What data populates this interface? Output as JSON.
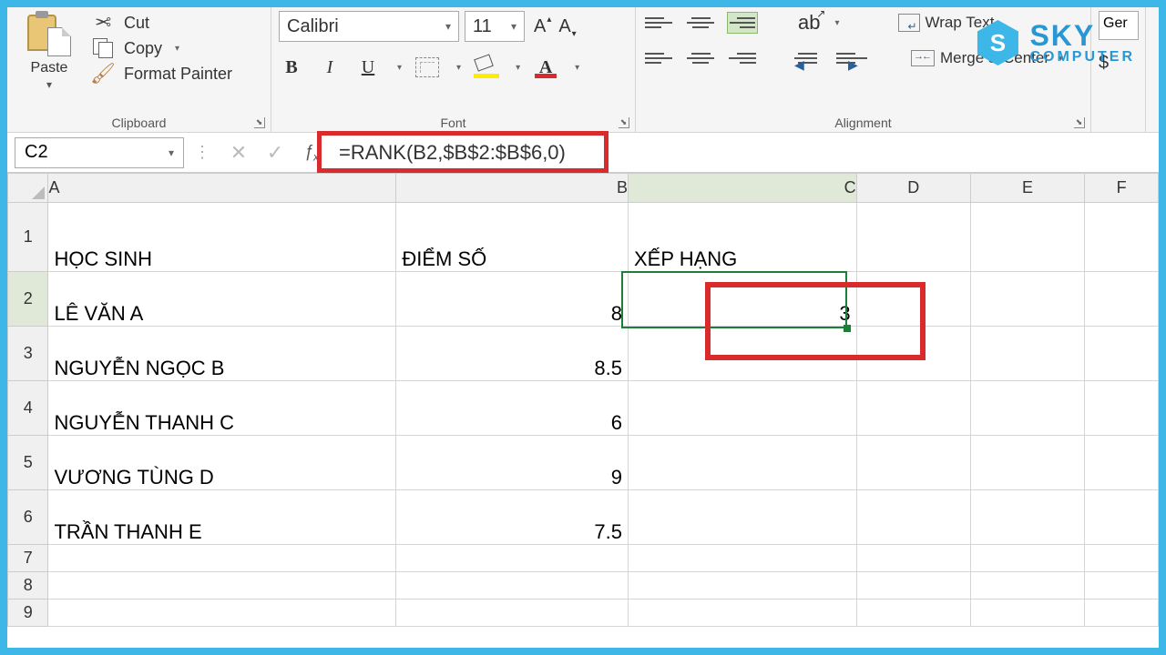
{
  "ribbon": {
    "clipboard": {
      "label": "Clipboard",
      "paste": "Paste",
      "cut": "Cut",
      "copy": "Copy",
      "format_painter": "Format Painter"
    },
    "font": {
      "label": "Font",
      "name": "Calibri",
      "size": "11",
      "increase": "A",
      "decrease": "A",
      "bold": "B",
      "italic": "I",
      "underline": "U",
      "font_color_letter": "A"
    },
    "alignment": {
      "label": "Alignment",
      "wrap": "Wrap Text",
      "merge": "Merge & Center"
    },
    "number": {
      "format": "Ger",
      "currency": "$"
    }
  },
  "logo": {
    "line1": "SKY",
    "line2": "COMPUTER",
    "mark": "S"
  },
  "name_box": "C2",
  "formula": "=RANK(B2,$B$2:$B$6,0)",
  "columns": [
    "A",
    "B",
    "C",
    "D",
    "E",
    "F"
  ],
  "row_nums": [
    "1",
    "2",
    "3",
    "4",
    "5",
    "6",
    "7",
    "8",
    "9"
  ],
  "headers": {
    "a": "HỌC SINH",
    "b": "ĐIỂM SỐ",
    "c": "XẾP HẠNG"
  },
  "rows": [
    {
      "a": "LÊ VĂN A",
      "b": "8",
      "c": "3"
    },
    {
      "a": "NGUYỄN NGỌC B",
      "b": "8.5",
      "c": ""
    },
    {
      "a": "NGUYỄN THANH C",
      "b": "6",
      "c": ""
    },
    {
      "a": "VƯƠNG TÙNG D",
      "b": "9",
      "c": ""
    },
    {
      "a": "TRẦN THANH E",
      "b": "7.5",
      "c": ""
    }
  ]
}
